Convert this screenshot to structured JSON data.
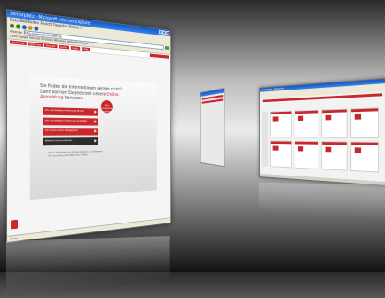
{
  "front_window": {
    "title": "Seniorplatz - Microsoft Internet Explorer",
    "menu": "Datei  Bearbeiten  Ansicht  Favoriten  Extras  ?",
    "address_label": "Adresse",
    "address_value": "http://www.seniorplatz.de",
    "bookmarks": "Links  Google  Hotmail  Windows  Windows Media  RealPlayer",
    "nav_tabs": [
      "Startseite",
      "Über uns",
      "Kontakt",
      "Suche",
      "Login",
      "Hilfe"
    ],
    "headline_part1": "Sie finden die Informationen gerade nicht? Dann können Sie jederzeit unsere ",
    "headline_link": "Online-Anmeldung",
    "headline_part2": " benutzen.",
    "badge_text": "Jetzt kostenlos anmelden",
    "options": [
      {
        "label": "Ich möchte eine Wohnung finden",
        "style": "red"
      },
      {
        "label": "Ich möchte eine Wohnung anbieten",
        "style": "red"
      },
      {
        "label": "Ich suche einen Pflegeplatz",
        "style": "red"
      },
      {
        "label": "Weitere Informationen",
        "style": "dark"
      }
    ],
    "note": "Wenn Sie Fragen zur Nutzung haben, kontaktieren Sie uns bitte per E-Mail oder Telefon.",
    "status": "Fertig"
  },
  "back_window": {
    "title": "Seniorplatz - Übersicht"
  },
  "colors": {
    "accent": "#c8282c",
    "titlebar": "#0a59c8"
  }
}
